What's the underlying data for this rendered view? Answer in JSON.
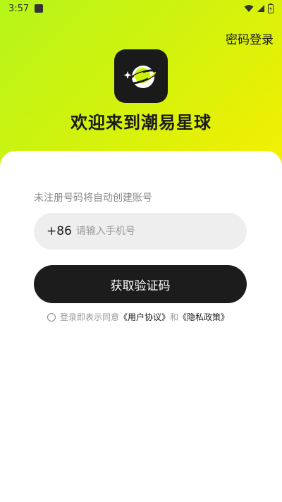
{
  "status_bar": {
    "time": "3:57"
  },
  "header": {
    "password_login": "密码登录"
  },
  "app": {
    "title": "欢迎来到潮易星球"
  },
  "form": {
    "hint": "未注册号码将自动创建账号",
    "country_code": "+86",
    "phone_placeholder": "请输入手机号",
    "get_code_label": "获取验证码"
  },
  "agreement": {
    "prefix": "登录即表示同意",
    "user_agreement": "《用户协议》",
    "and": "和",
    "privacy_policy": "《隐私政策》"
  },
  "colors": {
    "gradient_start": "#b6f51a",
    "gradient_end": "#f6ef00",
    "button_bg": "#1c1c1c"
  }
}
